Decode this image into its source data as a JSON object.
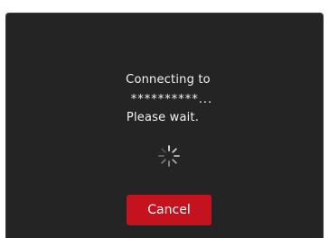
{
  "dialog": {
    "line1": "Connecting to",
    "line2": "**********...",
    "line3": "Please wait.",
    "cancel_label": "Cancel"
  },
  "colors": {
    "background": "#242424",
    "cancel_button": "#c4121f",
    "text": "#f2f2f2"
  },
  "icons": {
    "spinner": "loading-spinner-icon"
  }
}
